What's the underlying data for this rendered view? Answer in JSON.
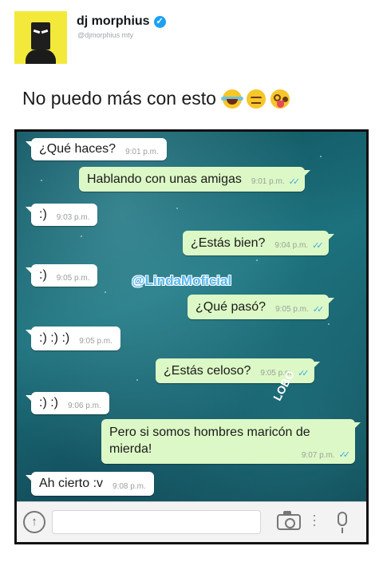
{
  "tweet": {
    "user_name": "dj morphius",
    "handle": "@djmorphius mty",
    "text": "No puedo más con esto",
    "emojis": [
      "face-with-tears-of-joy-icon",
      "pensive-face-icon",
      "zany-face-icon"
    ]
  },
  "chat": {
    "watermark": "@LindaMoficial",
    "stamp": "LOBO",
    "messages": [
      {
        "dir": "in",
        "text": "¿Qué haces?",
        "time": "9:01 p.m."
      },
      {
        "dir": "out",
        "text": "Hablando con unas amigas",
        "time": "9:01 p.m."
      },
      {
        "dir": "in",
        "text": ":)",
        "time": "9:03 p.m."
      },
      {
        "dir": "out",
        "text": "¿Estás bien?",
        "time": "9:04 p.m."
      },
      {
        "dir": "in",
        "text": ":)",
        "time": "9:05 p.m."
      },
      {
        "dir": "out",
        "text": "¿Qué pasó?",
        "time": "9:05 p.m."
      },
      {
        "dir": "in",
        "text": ":) :) :)",
        "time": "9:05 p.m."
      },
      {
        "dir": "out",
        "text": "¿Estás celoso?",
        "time": "9:05 p.m."
      },
      {
        "dir": "in",
        "text": ":) :)",
        "time": "9:06 p.m."
      },
      {
        "dir": "out",
        "text": "Pero si somos hombres maricón de mierda!",
        "time": "9:07 p.m."
      },
      {
        "dir": "in",
        "text": "Ah cierto :v",
        "time": "9:08 p.m."
      }
    ],
    "read_ticks": "✓✓",
    "colors": {
      "incoming": "#ffffff",
      "outgoing": "#dcf8c6",
      "ticks": "#3fa9e6"
    }
  }
}
